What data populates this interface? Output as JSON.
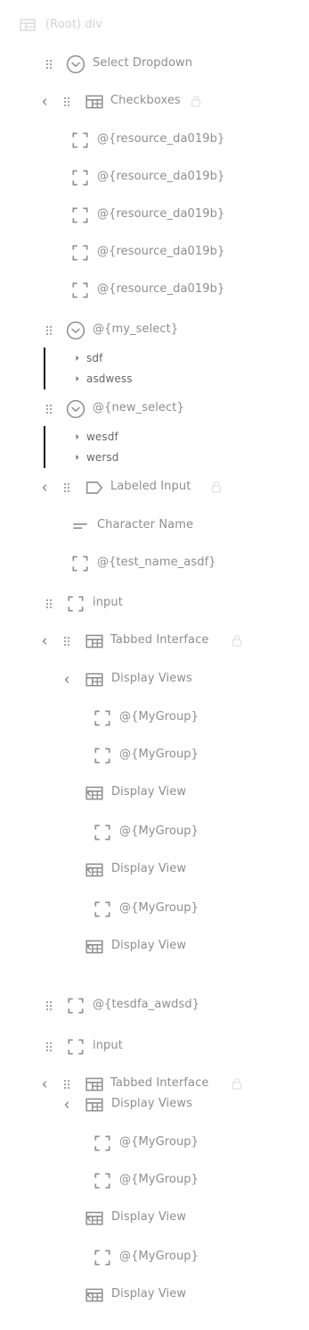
{
  "tree": {
    "root_label": "(Root) div",
    "nodes": [
      {
        "label": "Select Dropdown",
        "icon": "dropdown-icon"
      },
      {
        "label": "Checkboxes",
        "icon": "layout-icon",
        "locked": true,
        "collapsible": true
      },
      {
        "label": "@{resource_da019b}",
        "icon": "frame-icon"
      },
      {
        "label": "@{resource_da019b}",
        "icon": "frame-icon"
      },
      {
        "label": "@{resource_da019b}",
        "icon": "frame-icon"
      },
      {
        "label": "@{resource_da019b}",
        "icon": "frame-icon"
      },
      {
        "label": "@{resource_da019b}",
        "icon": "frame-icon"
      },
      {
        "label": "@{my_select}",
        "icon": "dropdown-icon",
        "options": [
          "sdf",
          "asdwess"
        ]
      },
      {
        "label": "@{new_select}",
        "icon": "dropdown-icon",
        "options": [
          "wesdf",
          "wersd"
        ]
      },
      {
        "label": "Labeled Input",
        "icon": "label-icon",
        "locked": true,
        "collapsible": true
      },
      {
        "label": "Character Name",
        "icon": "text-lines-icon"
      },
      {
        "label": "@{test_name_asdf}",
        "icon": "frame-icon"
      },
      {
        "label": "input",
        "icon": "frame-icon"
      },
      {
        "label": "Tabbed Interface",
        "icon": "layout-icon",
        "locked": true,
        "collapsible": true
      },
      {
        "label": "Display Views",
        "icon": "layout-icon",
        "collapsible": true
      },
      {
        "label": "@{MyGroup}",
        "icon": "frame-icon"
      },
      {
        "label": "@{MyGroup}",
        "icon": "frame-icon"
      },
      {
        "label": "Display View",
        "icon": "layout-icon",
        "collapsible": true
      },
      {
        "label": "@{MyGroup}",
        "icon": "frame-icon"
      },
      {
        "label": "Display View",
        "icon": "layout-icon",
        "collapsible": true
      },
      {
        "label": "@{MyGroup}",
        "icon": "frame-icon"
      },
      {
        "label": "Display View",
        "icon": "layout-icon",
        "collapsible": true
      },
      {
        "label": "@{tesdfa_awdsd}",
        "icon": "frame-icon"
      },
      {
        "label": "input",
        "icon": "frame-icon"
      },
      {
        "label": "Tabbed Interface",
        "icon": "layout-icon",
        "locked": true,
        "collapsible": true
      },
      {
        "label": "Display Views",
        "icon": "layout-icon",
        "collapsible": true
      },
      {
        "label": "@{MyGroup}",
        "icon": "frame-icon"
      },
      {
        "label": "@{MyGroup}",
        "icon": "frame-icon"
      },
      {
        "label": "Display View",
        "icon": "layout-icon",
        "collapsible": true
      },
      {
        "label": "@{MyGroup}",
        "icon": "frame-icon"
      },
      {
        "label": "Display View",
        "icon": "layout-icon",
        "collapsible": true
      }
    ]
  }
}
